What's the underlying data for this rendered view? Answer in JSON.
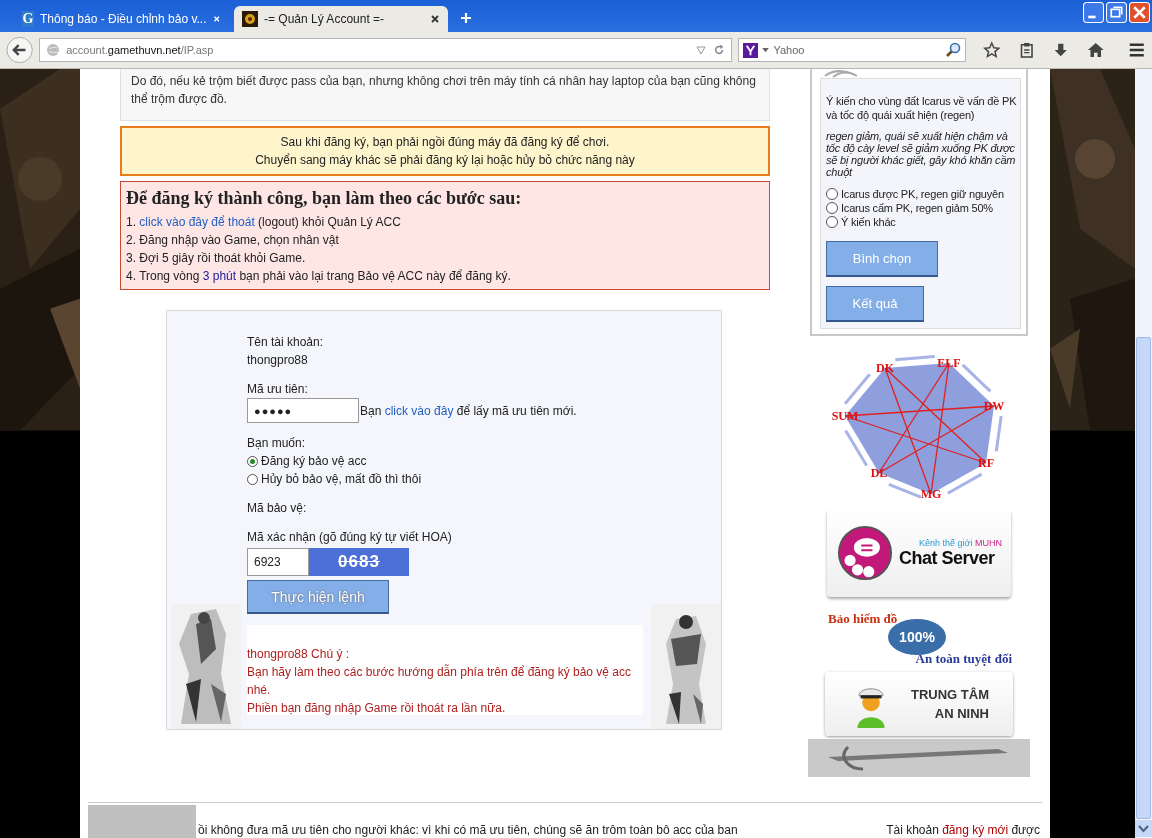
{
  "browser": {
    "tabs": [
      {
        "title": "Thông báo - Điều chỉnh bảo v...",
        "selected": false,
        "kind": "letter",
        "favicon": "G"
      },
      {
        "title": "-= Quản Lý Account =-",
        "selected": true
      }
    ],
    "url": {
      "host_prefix": "account.",
      "host": "gamethuvn.net",
      "path": "/IP.asp"
    },
    "search": {
      "placeholder": "Yahoo"
    }
  },
  "intro": "Do đó, nếu kẻ trộm biết được pass của bạn, nhưng không chơi trên máy tính cá nhân hay laptop của bạn cũng không thể trộm được đồ.",
  "notice": [
    "Sau khi đăng ký, bạn phải ngồi đúng máy đã đăng ký để chơi.",
    "Chuyển sang máy khác sẽ phải đăng ký lại hoặc hủy bỏ chức năng này"
  ],
  "steps": {
    "title": "Để đăng ký thành công, bạn làm theo các bước sau:",
    "items": [
      [
        {
          "text": "1. "
        },
        {
          "text": "click vào đây để thoát",
          "kind": "link"
        },
        {
          "text": " (logout) khỏi Quản Lý ACC"
        }
      ],
      [
        {
          "text": "2. Đăng nhập vào Game, chọn nhân vật"
        }
      ],
      [
        {
          "text": "3. Đợi 5 giây rồi thoát khỏi Game."
        }
      ],
      [
        {
          "text": "4. Trong vòng "
        },
        {
          "text": "3 phút",
          "kind": "emph"
        },
        {
          "text": " bạn phải vào lại trang Bảo vệ ACC này để đăng ký."
        }
      ]
    ]
  },
  "form": {
    "account_label": "Tên tài khoản:",
    "account_value": "thongpro88",
    "priority_label": "Mã ưu tiên:",
    "priority_value": "●●●●●",
    "priority_hint": [
      {
        "text": "Bạn "
      },
      {
        "text": "click vào đây",
        "kind": "link"
      },
      {
        "text": " để lấy mã ưu tiên mới."
      }
    ],
    "want_label": "Bạn muốn:",
    "options": [
      {
        "label": "Đăng ký bảo vệ acc",
        "selected": true
      },
      {
        "label": "Hủy bỏ bảo vệ, mất đồ thì thôi",
        "selected": false
      }
    ],
    "protect_label": "Mã bảo vệ:",
    "captcha_label": "Mã xác nhận (gõ đúng ký tự viết HOA)",
    "captcha_value": "6923",
    "captcha_image": "0683",
    "submit": "Thực hiện lệnh",
    "note": [
      "thongpro88 Chú ý :",
      "Bạn hãy làm theo các bước hướng dẫn phía trên để đăng ký bảo vệ acc nhé.",
      "Phiền bạn đăng nhập Game rồi thoát ra lần nữa."
    ]
  },
  "poll": {
    "question": "Ý kiến cho vùng đất Icarus về vấn đề PK và tốc độ quái xuất hiện (regen)",
    "note": "regen giảm, quái sẽ xuất hiện chậm và tốc độ cày level sẽ giảm xuống PK được sẽ bị người khác giết, gây khó khăn cầm chuột",
    "options": [
      {
        "label": "Icarus được PK, regen giữ nguyên",
        "selected": false
      },
      {
        "label": "Icarus cấm PK, regen giảm 50%",
        "selected": false
      },
      {
        "label": "Ý kiến khác",
        "selected": false
      }
    ],
    "buttons": [
      "Bình chọn",
      "Kết quả"
    ]
  },
  "class_diagram": {
    "labels": [
      "DK",
      "ELF",
      "DW",
      "RF",
      "MG",
      "DL",
      "SUM"
    ]
  },
  "chat_banner": {
    "subtitle_prefix": "Kênh thế giới ",
    "subtitle_brand": "MUHN",
    "title": "Chat Server"
  },
  "insurance_banner": {
    "title": "Bảo hiểm đồ",
    "seal": "100%",
    "slogan": "An toàn tuyệt đối"
  },
  "security_banner": {
    "lines": [
      "TRUNG TÂM",
      "AN NINH"
    ]
  },
  "footer": {
    "marquee": "ồi không đưa mã ưu tiên cho người khác: vì khi có mã ưu tiên, chúng sẽ ăn trôm toàn bô acc của ban",
    "right": [
      {
        "text": "Tài khoản "
      },
      {
        "text": "đăng ký mới",
        "kind": "link"
      },
      {
        "text": " được"
      }
    ]
  }
}
